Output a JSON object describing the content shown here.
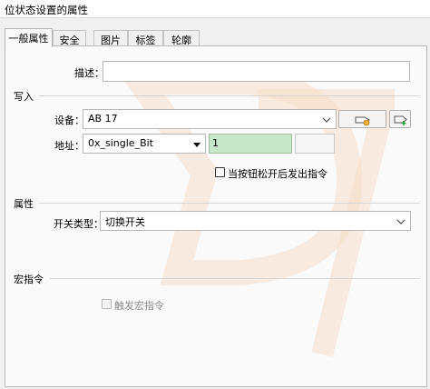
{
  "window": {
    "title": "位状态设置的属性"
  },
  "tabs": [
    {
      "label": "一般属性"
    },
    {
      "label": "安全"
    },
    {
      "label": "图片"
    },
    {
      "label": "标签"
    },
    {
      "label": "轮廓"
    }
  ],
  "general": {
    "description_label": "描述：",
    "description_value": ""
  },
  "write": {
    "section_title": "写入",
    "device_label": "设备：",
    "device_value": "AB 17",
    "address_label": "地址：",
    "address_type": "0x_single_Bit",
    "address_value": "1",
    "on_release_label": "当按钮松开后发出指令"
  },
  "attribute": {
    "section_title": "属性",
    "switch_type_label": "开关类型：",
    "switch_type_value": "切换开关"
  },
  "macro": {
    "section_title": "宏指令",
    "trigger_macro_label": "触发宏指令"
  },
  "colors": {
    "address_value_bg": "#c8e6c9",
    "watermark": "#f6dcc6"
  }
}
